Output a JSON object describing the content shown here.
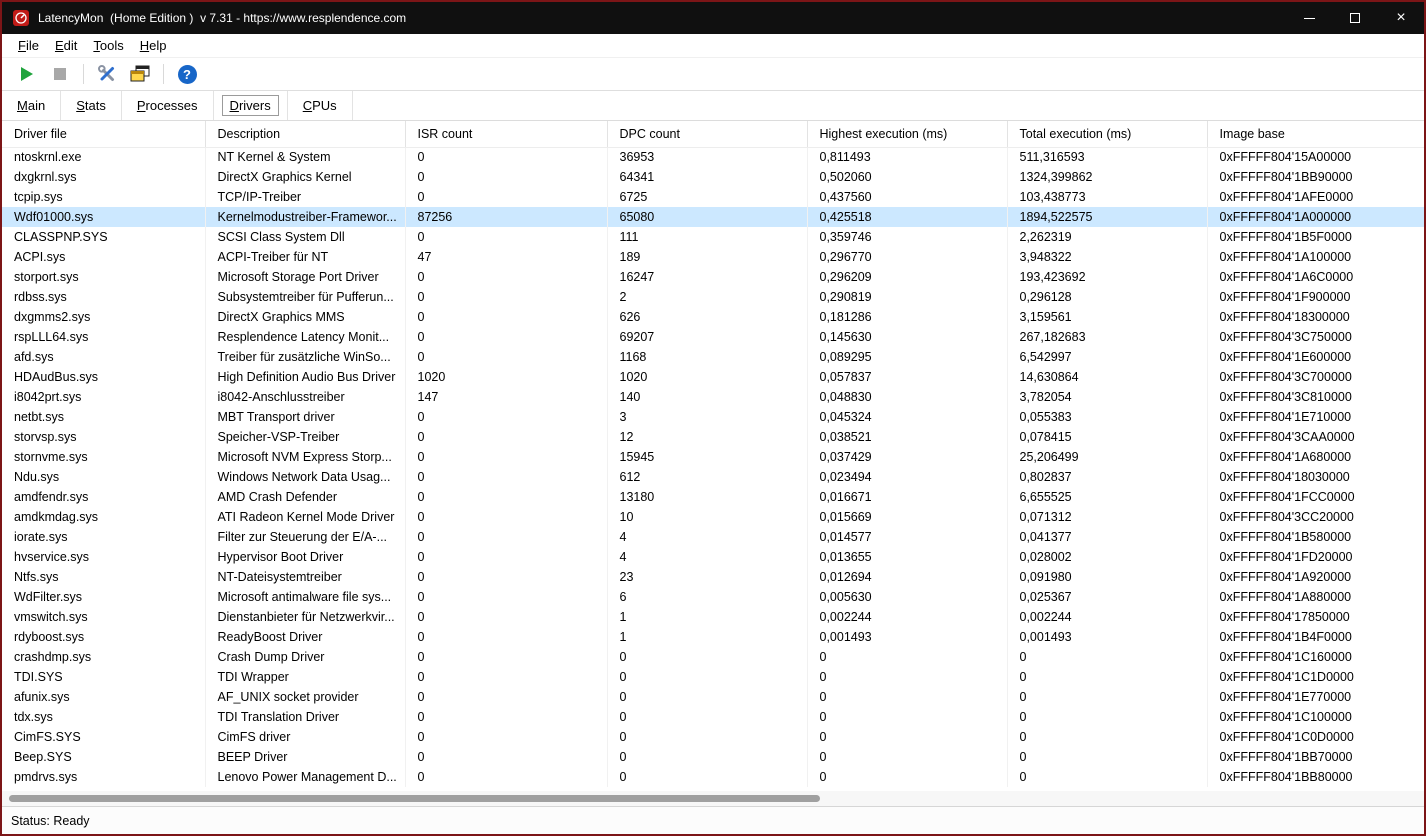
{
  "window": {
    "title": "LatencyMon  (Home Edition )  v 7.31 - https://www.resplendence.com",
    "controls": [
      "minimize",
      "maximize",
      "close"
    ]
  },
  "icons": {
    "help_glyph": "?",
    "close_glyph": "×"
  },
  "menu": {
    "items": [
      "File",
      "Edit",
      "Tools",
      "Help"
    ]
  },
  "toolbar": {
    "buttons": [
      "start-monitor",
      "stop-monitor",
      "options",
      "windows",
      "help"
    ],
    "stop_enabled": false
  },
  "tabs": {
    "items": [
      "Main",
      "Stats",
      "Processes",
      "Drivers",
      "CPUs"
    ],
    "active": "Drivers"
  },
  "table": {
    "columns": [
      "Driver file",
      "Description",
      "ISR count",
      "DPC count",
      "Highest execution (ms)",
      "Total execution (ms)",
      "Image base"
    ],
    "selected_row_index": 3,
    "rows": [
      [
        "ntoskrnl.exe",
        "NT Kernel & System",
        "0",
        "36953",
        "0,811493",
        "511,316593",
        "0xFFFFF804'15A00000"
      ],
      [
        "dxgkrnl.sys",
        "DirectX Graphics Kernel",
        "0",
        "64341",
        "0,502060",
        "1324,399862",
        "0xFFFFF804'1BB90000"
      ],
      [
        "tcpip.sys",
        "TCP/IP-Treiber",
        "0",
        "6725",
        "0,437560",
        "103,438773",
        "0xFFFFF804'1AFE0000"
      ],
      [
        "Wdf01000.sys",
        "Kernelmodustreiber-Framewor...",
        "87256",
        "65080",
        "0,425518",
        "1894,522575",
        "0xFFFFF804'1A000000"
      ],
      [
        "CLASSPNP.SYS",
        "SCSI Class System Dll",
        "0",
        "111",
        "0,359746",
        "2,262319",
        "0xFFFFF804'1B5F0000"
      ],
      [
        "ACPI.sys",
        "ACPI-Treiber für NT",
        "47",
        "189",
        "0,296770",
        "3,948322",
        "0xFFFFF804'1A100000"
      ],
      [
        "storport.sys",
        "Microsoft Storage Port Driver",
        "0",
        "16247",
        "0,296209",
        "193,423692",
        "0xFFFFF804'1A6C0000"
      ],
      [
        "rdbss.sys",
        "Subsystemtreiber für Pufferun...",
        "0",
        "2",
        "0,290819",
        "0,296128",
        "0xFFFFF804'1F900000"
      ],
      [
        "dxgmms2.sys",
        "DirectX Graphics MMS",
        "0",
        "626",
        "0,181286",
        "3,159561",
        "0xFFFFF804'18300000"
      ],
      [
        "rspLLL64.sys",
        "Resplendence Latency Monit...",
        "0",
        "69207",
        "0,145630",
        "267,182683",
        "0xFFFFF804'3C750000"
      ],
      [
        "afd.sys",
        "Treiber für zusätzliche WinSo...",
        "0",
        "1168",
        "0,089295",
        "6,542997",
        "0xFFFFF804'1E600000"
      ],
      [
        "HDAudBus.sys",
        "High Definition Audio Bus Driver",
        "1020",
        "1020",
        "0,057837",
        "14,630864",
        "0xFFFFF804'3C700000"
      ],
      [
        "i8042prt.sys",
        "i8042-Anschlusstreiber",
        "147",
        "140",
        "0,048830",
        "3,782054",
        "0xFFFFF804'3C810000"
      ],
      [
        "netbt.sys",
        "MBT Transport driver",
        "0",
        "3",
        "0,045324",
        "0,055383",
        "0xFFFFF804'1E710000"
      ],
      [
        "storvsp.sys",
        "Speicher-VSP-Treiber",
        "0",
        "12",
        "0,038521",
        "0,078415",
        "0xFFFFF804'3CAA0000"
      ],
      [
        "stornvme.sys",
        "Microsoft NVM Express Storp...",
        "0",
        "15945",
        "0,037429",
        "25,206499",
        "0xFFFFF804'1A680000"
      ],
      [
        "Ndu.sys",
        "Windows Network Data Usag...",
        "0",
        "612",
        "0,023494",
        "0,802837",
        "0xFFFFF804'18030000"
      ],
      [
        "amdfendr.sys",
        "AMD Crash Defender",
        "0",
        "13180",
        "0,016671",
        "6,655525",
        "0xFFFFF804'1FCC0000"
      ],
      [
        "amdkmdag.sys",
        "ATI Radeon Kernel Mode Driver",
        "0",
        "10",
        "0,015669",
        "0,071312",
        "0xFFFFF804'3CC20000"
      ],
      [
        "iorate.sys",
        "Filter zur Steuerung der E/A-...",
        "0",
        "4",
        "0,014577",
        "0,041377",
        "0xFFFFF804'1B580000"
      ],
      [
        "hvservice.sys",
        "Hypervisor Boot Driver",
        "0",
        "4",
        "0,013655",
        "0,028002",
        "0xFFFFF804'1FD20000"
      ],
      [
        "Ntfs.sys",
        "NT-Dateisystemtreiber",
        "0",
        "23",
        "0,012694",
        "0,091980",
        "0xFFFFF804'1A920000"
      ],
      [
        "WdFilter.sys",
        "Microsoft antimalware file sys...",
        "0",
        "6",
        "0,005630",
        "0,025367",
        "0xFFFFF804'1A880000"
      ],
      [
        "vmswitch.sys",
        "Dienstanbieter für Netzwerkvir...",
        "0",
        "1",
        "0,002244",
        "0,002244",
        "0xFFFFF804'17850000"
      ],
      [
        "rdyboost.sys",
        "ReadyBoost Driver",
        "0",
        "1",
        "0,001493",
        "0,001493",
        "0xFFFFF804'1B4F0000"
      ],
      [
        "crashdmp.sys",
        "Crash Dump Driver",
        "0",
        "0",
        "0",
        "0",
        "0xFFFFF804'1C160000"
      ],
      [
        "TDI.SYS",
        "TDI Wrapper",
        "0",
        "0",
        "0",
        "0",
        "0xFFFFF804'1C1D0000"
      ],
      [
        "afunix.sys",
        "AF_UNIX socket provider",
        "0",
        "0",
        "0",
        "0",
        "0xFFFFF804'1E770000"
      ],
      [
        "tdx.sys",
        "TDI Translation Driver",
        "0",
        "0",
        "0",
        "0",
        "0xFFFFF804'1C100000"
      ],
      [
        "CimFS.SYS",
        "CimFS driver",
        "0",
        "0",
        "0",
        "0",
        "0xFFFFF804'1C0D0000"
      ],
      [
        "Beep.SYS",
        "BEEP Driver",
        "0",
        "0",
        "0",
        "0",
        "0xFFFFF804'1BB70000"
      ],
      [
        "pmdrvs.sys",
        "Lenovo Power Management D...",
        "0",
        "0",
        "0",
        "0",
        "0xFFFFF804'1BB80000"
      ]
    ]
  },
  "scrollbar": {
    "thumb_fraction": 0.57
  },
  "status_bar": {
    "text": "Status: Ready"
  },
  "colors": {
    "window_border": "#7c1517",
    "titlebar_bg": "#101010",
    "selected_row_bg": "#cce8ff",
    "help_blue": "#1766c8",
    "play_green": "#1fa33c"
  }
}
